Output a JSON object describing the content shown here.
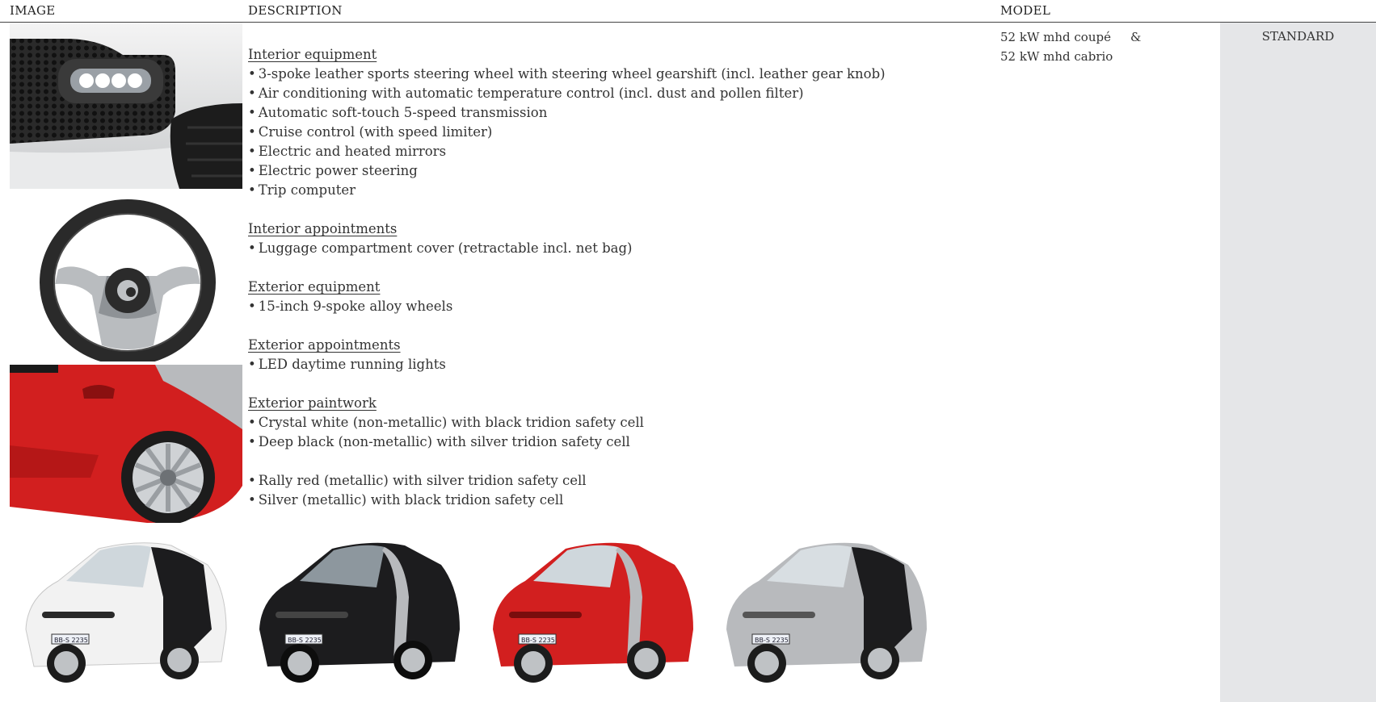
{
  "header": {
    "image": "IMAGE",
    "description": "DESCRIPTION",
    "model": "MODEL"
  },
  "model": {
    "line1": "52 kW mhd coupé",
    "amp": "&",
    "line2": "52 kW mhd cabrio"
  },
  "standard_label": "STANDARD",
  "sections": {
    "interior_equipment": {
      "title": "Interior equipment",
      "items": [
        "3-spoke leather sports steering wheel with steering wheel gearshift (incl. leather gear knob)",
        "Air conditioning with automatic temperature control (incl. dust and pollen filter)",
        "Automatic soft-touch 5-speed transmission",
        "Cruise control (with speed limiter)",
        "Electric and heated mirrors",
        "Electric power steering",
        "Trip computer"
      ]
    },
    "interior_appointments": {
      "title": "Interior appointments",
      "items": [
        "Luggage compartment cover (retractable incl. net bag)"
      ]
    },
    "exterior_equipment": {
      "title": "Exterior equipment",
      "items": [
        "15-inch 9-spoke alloy wheels"
      ]
    },
    "exterior_appointments": {
      "title": "Exterior appointments",
      "items": [
        "LED daytime running lights"
      ]
    },
    "exterior_paintwork": {
      "title": "Exterior paintwork",
      "items": [
        "Crystal white (non-metallic) with black tridion safety cell",
        "Deep black (non-metallic) with silver tridion safety cell",
        "Rally red (metallic) with silver tridion safety cell",
        "Silver (metallic) with black tridion safety cell"
      ]
    }
  },
  "car_plate_text": "BB-S 2235",
  "colors": {
    "standard_column": "#e5e6e8",
    "rally_red": "#d21f1f",
    "deep_black": "#1c1c1e",
    "crystal_white": "#f2f2f2",
    "silver": "#b8babd"
  }
}
